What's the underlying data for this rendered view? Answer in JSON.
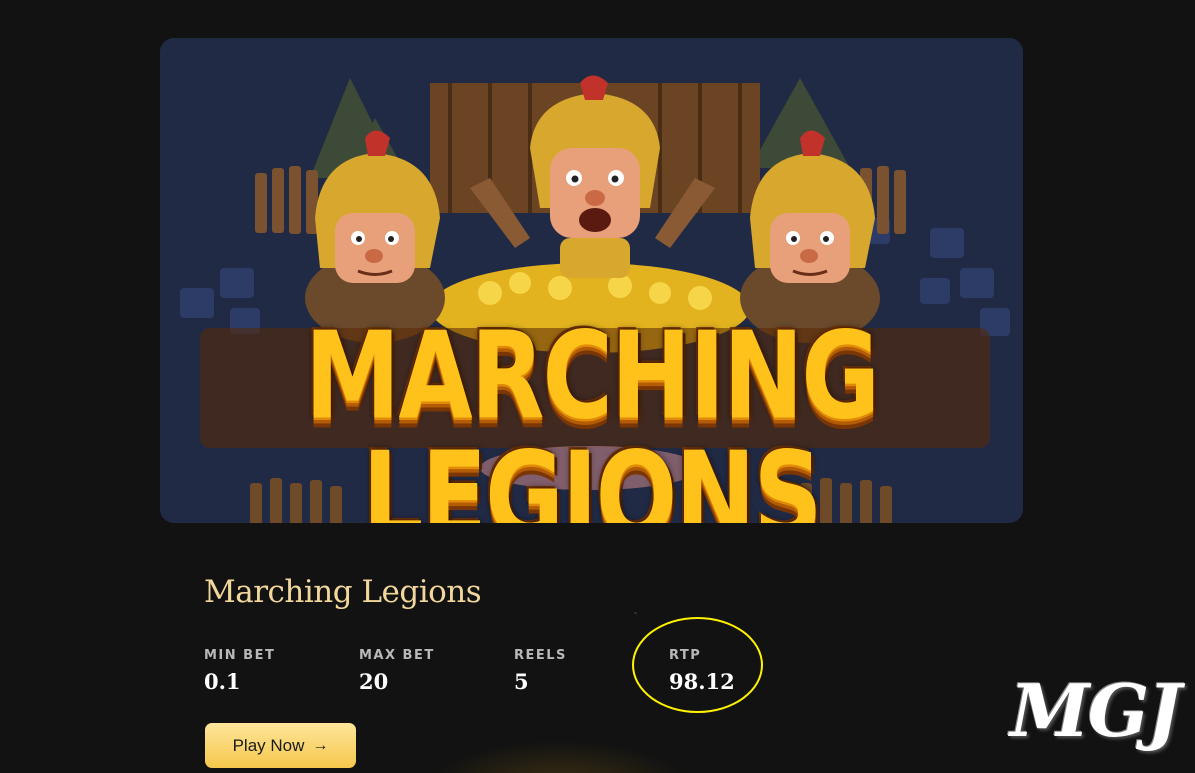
{
  "hero": {
    "logo_text": "MARCHING LEGIONS"
  },
  "game": {
    "title": "Marching Legions",
    "stats": [
      {
        "label": "MIN BET",
        "value": "0.1"
      },
      {
        "label": "MAX BET",
        "value": "20"
      },
      {
        "label": "REELS",
        "value": "5"
      },
      {
        "label": "RTP",
        "value": "98.12"
      }
    ],
    "play_label": "Play Now",
    "play_icon": "arrow-right-icon"
  },
  "watermark": {
    "text": "MGJ"
  },
  "colors": {
    "background": "#121212",
    "title": "#f1d79b",
    "button": "#f6c84c",
    "highlight_circle": "#fff200",
    "logo_gold": "#ffc21a"
  }
}
